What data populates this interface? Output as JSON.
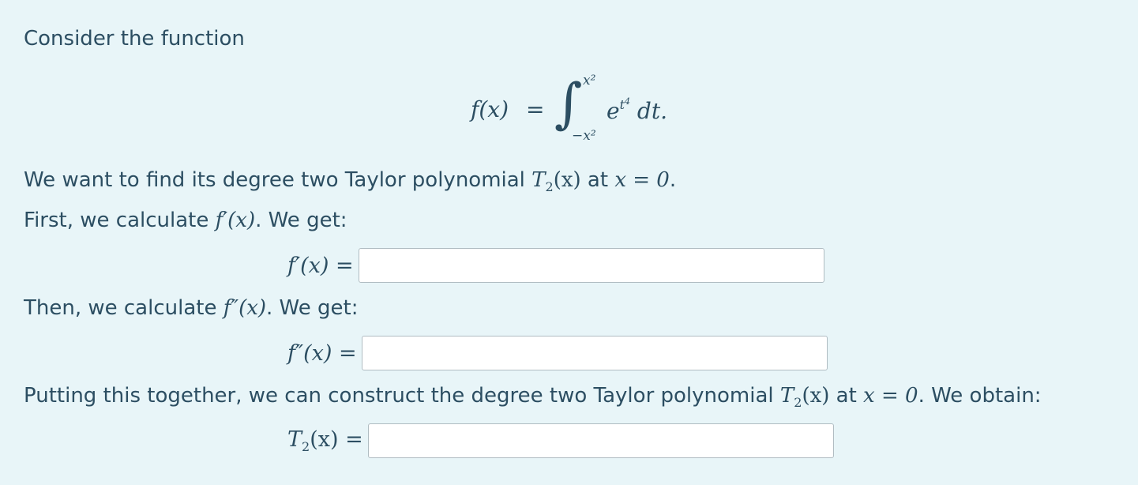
{
  "intro_text": "Consider the function",
  "display": {
    "lhs": "f(x)",
    "equals": "=",
    "integral_sign": "∫",
    "upper_limit": "x²",
    "lower_limit": "−x²",
    "integrand_base": "e",
    "integrand_exp_base": "t",
    "integrand_exp_power": "4",
    "differential": " dt."
  },
  "goal": {
    "text_before": "We want to find its degree two Taylor polynomial ",
    "T": "T",
    "T_sub": "2",
    "Tx": "(x)",
    "at": " at ",
    "x_eq_0": "x = 0",
    "period": "."
  },
  "step1": {
    "text_before": "First, we calculate ",
    "fprime": "f′(x)",
    "text_after": ". We get:"
  },
  "answer1": {
    "label": "f′(x) =",
    "value": ""
  },
  "step2": {
    "text_before": "Then, we calculate ",
    "fdouble": "f″(x)",
    "text_after": ". We get:"
  },
  "answer2": {
    "label": "f″(x) =",
    "value": ""
  },
  "step3": {
    "text_before": "Putting this together, we can construct the degree two Taylor polynomial ",
    "T": "T",
    "T_sub": "2",
    "Tx": "(x)",
    "at": " at ",
    "x_eq_0": "x = 0",
    "text_after": ". We obtain:"
  },
  "answer3": {
    "label_T": "T",
    "label_sub": "2",
    "label_rest": "(x) =",
    "value": ""
  }
}
